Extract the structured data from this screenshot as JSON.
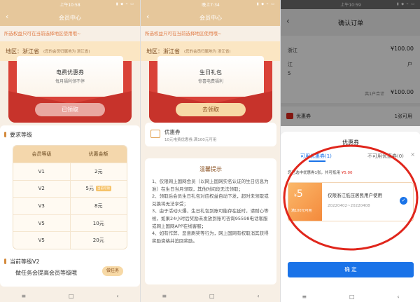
{
  "p1": {
    "status_time": "上午10:58",
    "status_icons": "▮ ◆ ⌁ ▭",
    "title": "会员中心",
    "notice": "所选权益只可在当前选择地区使用哦~",
    "region_label": "地区：浙江省",
    "region_tip": "(您的会员归属地为 浙江省)",
    "card_title": "电费优惠券",
    "card_sub": "每月福利领不停",
    "claim_label": "已领取",
    "section_title": "要求等级",
    "table_headers": [
      "会员等级",
      "优惠金额"
    ],
    "rows": [
      {
        "level": "V1",
        "amount": "2元"
      },
      {
        "level": "V2",
        "amount": "5元"
      },
      {
        "level": "V3",
        "amount": "8元"
      },
      {
        "level": "V5",
        "amount": "10元"
      },
      {
        "level": "V5",
        "amount": "20元"
      }
    ],
    "current_badge": "当前可领",
    "current_level": "当前等级V2",
    "upgrade_text": "做任务会提高会员等级哦",
    "upgrade_button": "做任务"
  },
  "p2": {
    "status_time": "晚上7:34",
    "status_icons": "▮ ◆ ⌁ ▭",
    "title": "会员中心",
    "notice": "所选权益只可在当前选择地区使用哦~",
    "region_label": "地区：浙江省",
    "region_tip": "(您的会员归属地为 浙江省)",
    "card_title": "生日礼包",
    "card_sub": "惊喜电费福利",
    "claim_label": "去领取",
    "coupon_title": "优惠券",
    "coupon_sub": "10元电费优惠券,满100元可用",
    "rules_title": "温馨提示",
    "rules_text": "1、仅限网上国网会员（以网上国网实名认证的生日信息为准）在生日当月领取，其他时间段无法领取；\n2、领取后会员生日礼包对应权益自动下发，超时未领取或兑换将无法享受；\n3、由于活动火爆，生日礼包到账可能存在延时，请耐心等候，如果24小时后奖励未发放到账可咨询95598电话客服或网上国网APP在线客服；\n4、如有作弊、恶意刷奖等行为，网上国网有权取消其获得奖励资格并追回奖励。"
  },
  "p3": {
    "status_time": "上午10:59",
    "status_icons": "▮ ◆ ⌁ ▭",
    "title": "确认订单",
    "region": "浙江",
    "amount1": "¥100.00",
    "line2": "江",
    "line2_right": "户",
    "line3": "5",
    "total_label": "共1户合计",
    "total_amount": "¥100.00",
    "coupon_label": "优惠券",
    "coupon_avail": "1张可用",
    "sheet_title": "优惠券",
    "tab_available": "可用优惠券(1)",
    "tab_unavailable": "不可用优惠券(0)",
    "selected_text": "您已选中优惠券1张，共可抵用",
    "selected_amount": "¥5.00",
    "coupon_value": "5",
    "coupon_currency": "¥",
    "coupon_condition": "满100元可用",
    "coupon_desc": "仅限浙江低压居民用户使用",
    "coupon_dates": "20220402~20220408",
    "confirm_label": "确 定",
    "close_icon": "×"
  },
  "colors": {
    "accent": "#1a73e8",
    "red": "#d94238",
    "gold": "#e6c79b",
    "highlight": "#e0261c"
  }
}
